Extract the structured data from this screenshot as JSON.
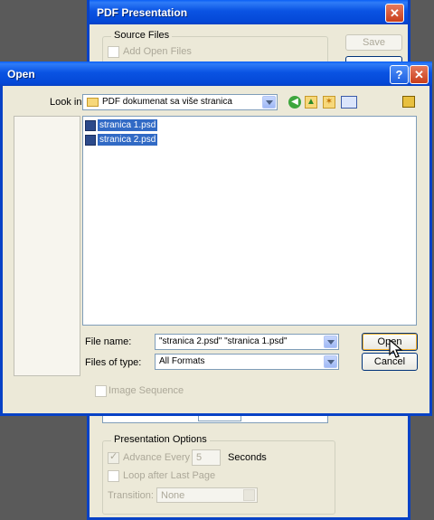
{
  "pdf_dialog": {
    "title": "PDF Presentation",
    "source_files_legend": "Source Files",
    "add_open_files": "Add Open Files",
    "save_button": "Save",
    "presentation_options_legend": "Presentation Options",
    "advance_every": "Advance Every",
    "advance_value": "5",
    "seconds": "Seconds",
    "loop_after_last_page": "Loop after Last Page",
    "transition_label": "Transition:",
    "transition_value": "None"
  },
  "open_dialog": {
    "title": "Open",
    "look_in_label": "Look in:",
    "look_in_value": "PDF dokumenat sa više stranica",
    "files": [
      "stranica 1.psd",
      "stranica 2.psd"
    ],
    "file_name_label": "File name:",
    "file_name_value": "\"stranica 2.psd\" \"stranica 1.psd\"",
    "files_of_type_label": "Files of type:",
    "files_of_type_value": "All Formats",
    "open_button": "Open",
    "cancel_button": "Cancel",
    "image_sequence": "Image Sequence"
  },
  "icons": {
    "folder": "folder-icon",
    "back": "back-icon",
    "up": "up-folder-icon",
    "new_folder": "new-folder-icon",
    "views": "views-menu-icon",
    "help": "help-icon",
    "close": "close-icon"
  },
  "colors": {
    "titlebar": "#0a53e3",
    "dialog_bg": "#ece9d8",
    "selection": "#316ac5"
  }
}
